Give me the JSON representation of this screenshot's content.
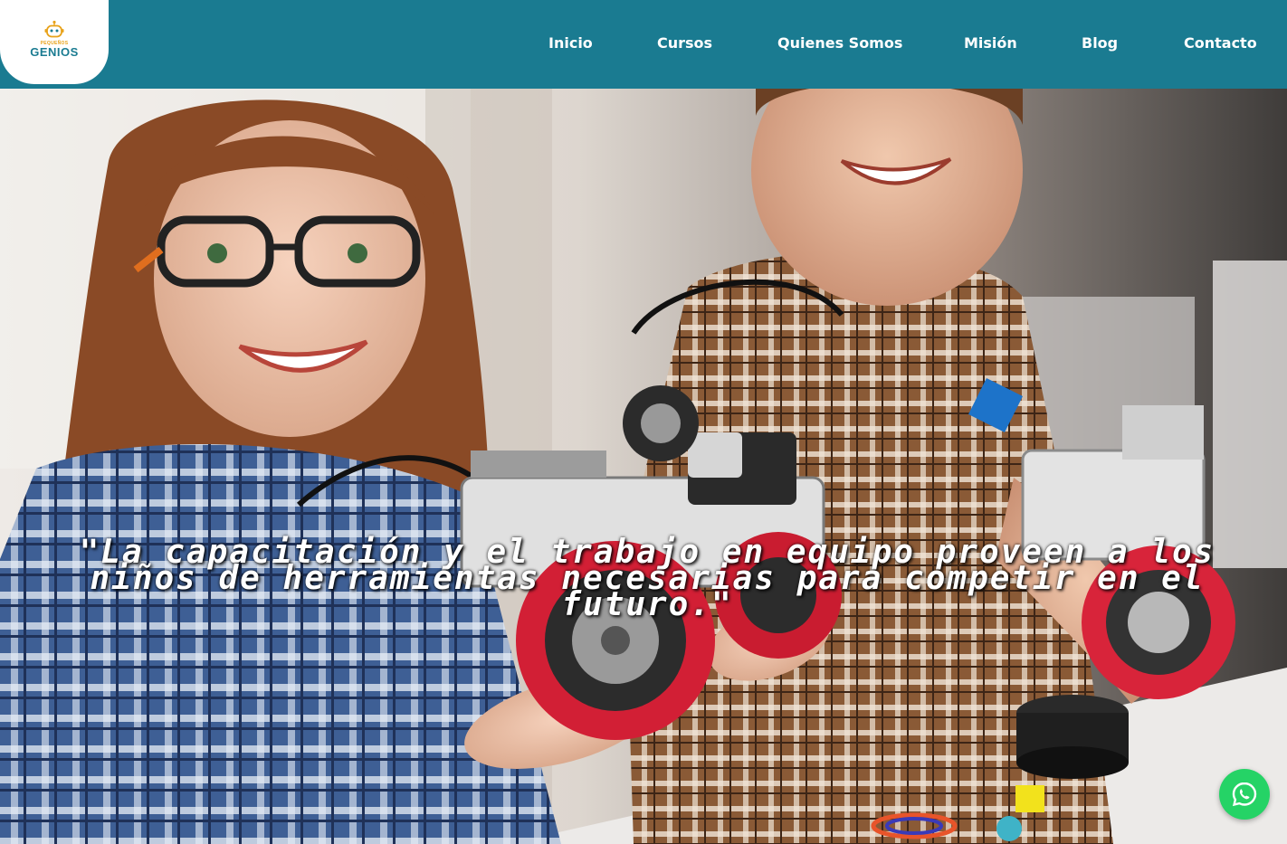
{
  "logo": {
    "small_text": "PEQUEÑOS",
    "big_text": "GENIOS",
    "icon": "robot-icon"
  },
  "nav": {
    "items": [
      {
        "label": "Inicio"
      },
      {
        "label": "Cursos"
      },
      {
        "label": "Quienes Somos"
      },
      {
        "label": "Misión"
      },
      {
        "label": "Blog"
      },
      {
        "label": "Contacto"
      }
    ]
  },
  "hero": {
    "quote": "\"La capacitación y el trabajo en equipo proveen a los niños de herramientas necesarias para competir en el futuro.\""
  },
  "whatsapp": {
    "icon": "whatsapp-icon"
  },
  "colors": {
    "header_bg": "#1a7b91",
    "whatsapp_green": "#25d366",
    "logo_orange": "#e8a21a"
  }
}
